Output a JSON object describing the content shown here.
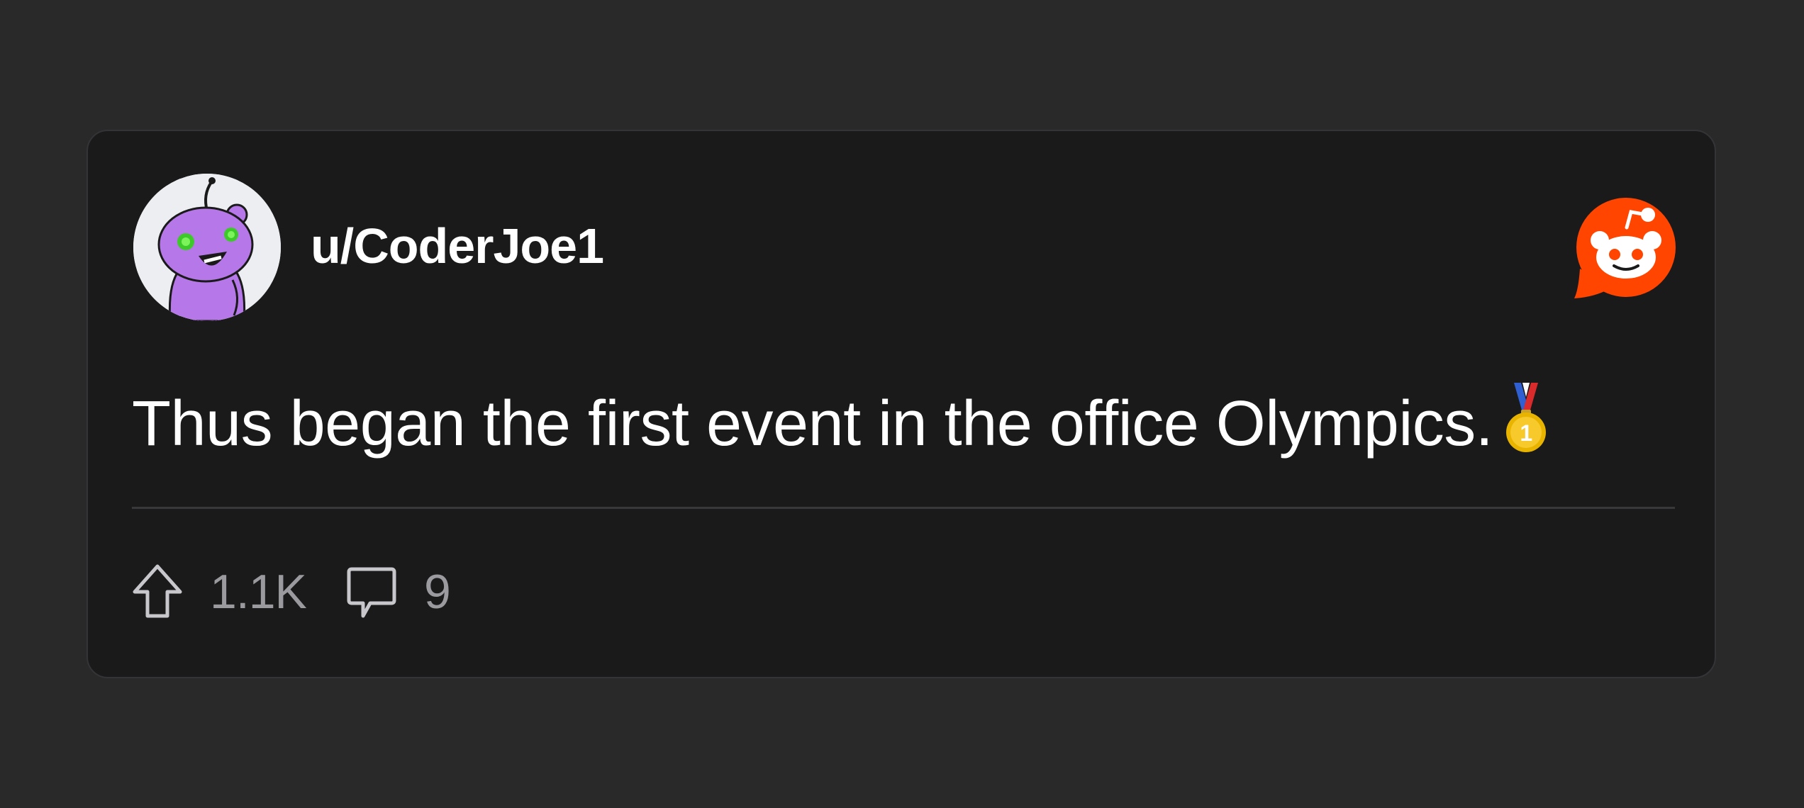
{
  "post": {
    "username": "u/CoderJoe1",
    "text": "Thus began the first event in the office Olympics.",
    "emoji_icon": "first-place-medal",
    "upvotes": "1.1K",
    "comments": "9"
  },
  "icons": {
    "avatar": "snoo-avatar-icon",
    "brand": "reddit-logo-icon",
    "upvote": "upvote-arrow-icon",
    "comment": "comment-bubble-icon"
  },
  "colors": {
    "page_background": "#292929",
    "card_background": "#1a1a1b",
    "brand": "#ff4500",
    "avatar_purple": "#b678e8",
    "muted_text": "#9b9b9f"
  }
}
